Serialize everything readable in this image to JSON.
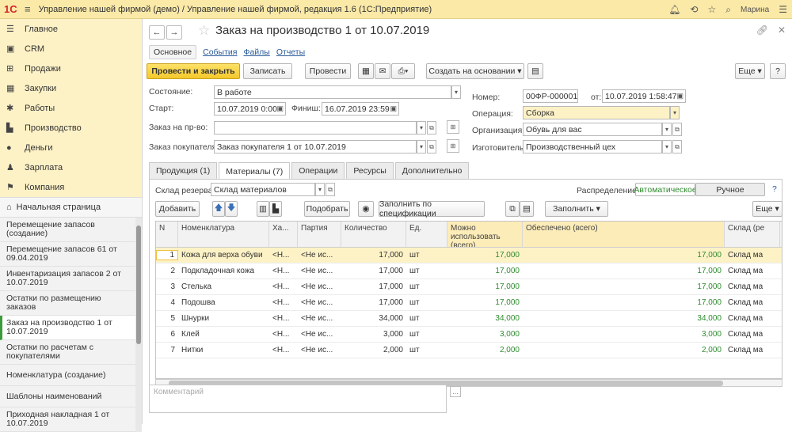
{
  "titlebar": {
    "logo": "1С",
    "title": "Управление нашей фирмой (демо) / Управление нашей фирмой, редакция 1.6  (1С:Предприятие)",
    "user": "Марина"
  },
  "sidebar": {
    "sections": [
      {
        "icon": "menu-icon",
        "glyph": "☰",
        "label": "Главное"
      },
      {
        "icon": "crm-icon",
        "glyph": "▣",
        "label": "CRM"
      },
      {
        "icon": "cart-icon",
        "glyph": "⊞",
        "label": "Продажи"
      },
      {
        "icon": "purchase-icon",
        "glyph": "▦",
        "label": "Закупки"
      },
      {
        "icon": "works-icon",
        "glyph": "✱",
        "label": "Работы"
      },
      {
        "icon": "production-icon",
        "glyph": "▙",
        "label": "Производство"
      },
      {
        "icon": "money-icon",
        "glyph": "●",
        "label": "Деньги"
      },
      {
        "icon": "salary-icon",
        "glyph": "♟",
        "label": "Зарплата"
      },
      {
        "icon": "company-icon",
        "glyph": "⚑",
        "label": "Компания"
      }
    ],
    "home_label": "Начальная страница",
    "open_items": [
      "Перемещение запасов (создание)",
      "Перемещение запасов 61 от 09.04.2019",
      "Инвентаризация запасов 2 от 10.07.2019",
      "Остатки по размещению заказов",
      "Заказ на производство 1 от 10.07.2019",
      "Остатки по расчетам с покупателями",
      "Номенклатура (создание)",
      "Шаблоны наименований",
      "Приходная накладная 1 от 10.07.2019"
    ]
  },
  "doc": {
    "title": "Заказ на производство 1 от 10.07.2019",
    "subtabs": {
      "main": "Основное",
      "events": "События",
      "files": "Файлы",
      "reports": "Отчеты"
    },
    "buttons": {
      "post_close": "Провести и закрыть",
      "save": "Записать",
      "post": "Провести",
      "create_based": "Создать на основании",
      "more": "Еще",
      "help": "?"
    },
    "fields": {
      "status_label": "Состояние:",
      "status": "В работе",
      "start_label": "Старт:",
      "start": "10.07.2019  0:00",
      "finish_label": "Финиш:",
      "finish": "16.07.2019 23:59",
      "order_label": "Заказ на пр-во:",
      "order": "",
      "customer_order_label": "Заказ покупателя:",
      "customer_order": "Заказ покупателя 1 от 10.07.2019",
      "number_label": "Номер:",
      "number": "00ФР-000001",
      "date_label": "от:",
      "date": "10.07.2019  1:58:47",
      "operation_label": "Операция:",
      "operation": "Сборка",
      "org_label": "Организация:",
      "org": "Обувь для вас",
      "maker_label": "Изготовитель:",
      "maker": "Производственный цех"
    },
    "tabs": [
      "Продукция (1)",
      "Материалы (7)",
      "Операции",
      "Ресурсы",
      "Дополнительно"
    ],
    "materials": {
      "warehouse_label": "Склад резерва:",
      "warehouse": "Склад материалов",
      "distribution_label": "Распределение:",
      "dist_auto": "Автоматическое",
      "dist_manual": "Ручное",
      "help": "?",
      "add": "Добавить",
      "pick": "Подобрать",
      "fill_spec": "Заполнить по спецификации",
      "fill": "Заполнить",
      "more": "Еще",
      "columns": [
        "N",
        "Номенклатура",
        "Ха...",
        "Партия",
        "Количество",
        "Ед.",
        "Можно использовать (всего)",
        "Обеспечено (всего)",
        "Склад (ре"
      ],
      "rows": [
        {
          "n": "1",
          "name": "Кожа для верха обуви",
          "char": "<Н...",
          "batch": "<Не ис...",
          "qty": "17,000",
          "unit": "шт",
          "avail": "17,000",
          "provided": "17,000",
          "wh": "Склад ма"
        },
        {
          "n": "2",
          "name": "Подкладочная кожа",
          "char": "<Н...",
          "batch": "<Не ис...",
          "qty": "17,000",
          "unit": "шт",
          "avail": "17,000",
          "provided": "17,000",
          "wh": "Склад ма"
        },
        {
          "n": "3",
          "name": "Стелька",
          "char": "<Н...",
          "batch": "<Не ис...",
          "qty": "17,000",
          "unit": "шт",
          "avail": "17,000",
          "provided": "17,000",
          "wh": "Склад ма"
        },
        {
          "n": "4",
          "name": "Подошва",
          "char": "<Н...",
          "batch": "<Не ис...",
          "qty": "17,000",
          "unit": "шт",
          "avail": "17,000",
          "provided": "17,000",
          "wh": "Склад ма"
        },
        {
          "n": "5",
          "name": "Шнурки",
          "char": "<Н...",
          "batch": "<Не ис...",
          "qty": "34,000",
          "unit": "шт",
          "avail": "34,000",
          "provided": "34,000",
          "wh": "Склад ма"
        },
        {
          "n": "6",
          "name": "Клей",
          "char": "<Н...",
          "batch": "<Не ис...",
          "qty": "3,000",
          "unit": "шт",
          "avail": "3,000",
          "provided": "3,000",
          "wh": "Склад ма"
        },
        {
          "n": "7",
          "name": "Нитки",
          "char": "<Н...",
          "batch": "<Не ис...",
          "qty": "2,000",
          "unit": "шт",
          "avail": "2,000",
          "provided": "2,000",
          "wh": "Склад ма"
        }
      ]
    },
    "comment_placeholder": "Комментарий"
  }
}
